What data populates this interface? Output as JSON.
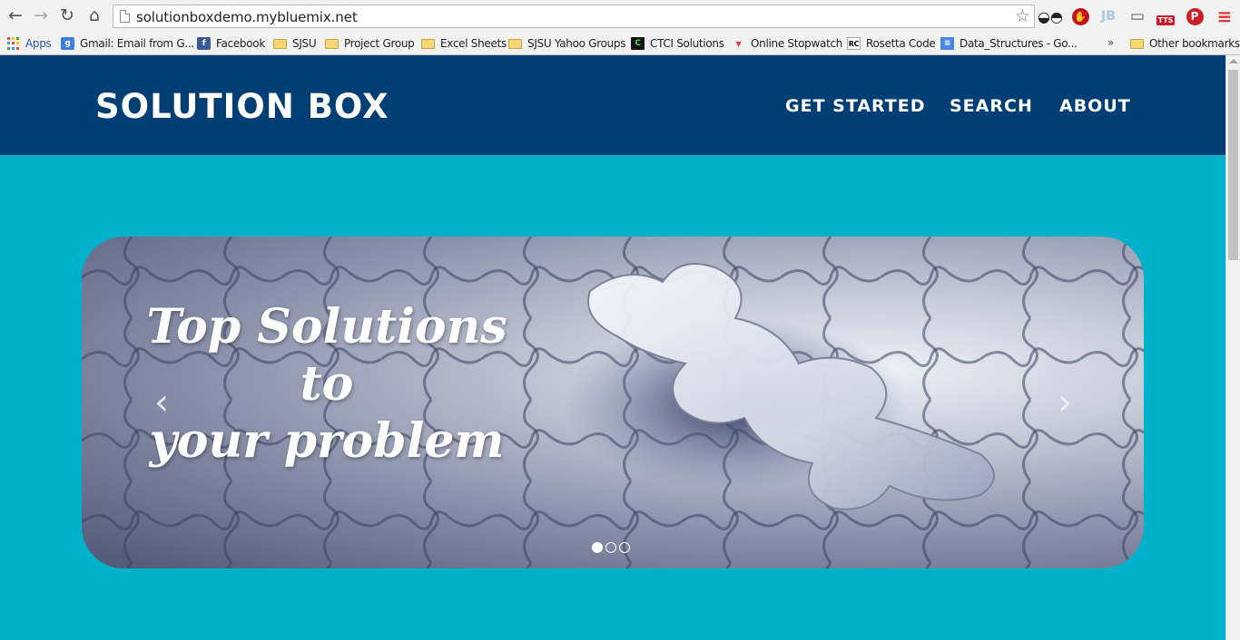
{
  "browser": {
    "url": "solutionboxdemo.mybluemix.net",
    "icons": {
      "back": "back-arrow-icon",
      "forward": "forward-arrow-icon",
      "reload": "reload-icon",
      "home": "home-icon",
      "star": "bookmark-star-icon"
    },
    "extensions": {
      "jb": "JB",
      "tts": "TTS"
    },
    "bookmarks": [
      {
        "label": "Apps",
        "icon": "apps-grid-icon"
      },
      {
        "label": "Gmail: Email from G...",
        "icon": "google-icon"
      },
      {
        "label": "Facebook",
        "icon": "facebook-icon"
      },
      {
        "label": "SJSU",
        "icon": "folder-icon"
      },
      {
        "label": "Project Group",
        "icon": "folder-icon"
      },
      {
        "label": "Excel Sheets",
        "icon": "folder-icon"
      },
      {
        "label": "SJSU Yahoo Groups",
        "icon": "folder-icon"
      },
      {
        "label": "CTCI Solutions",
        "icon": "ctci-icon"
      },
      {
        "label": "Online Stopwatch",
        "icon": "stopwatch-icon"
      },
      {
        "label": "Rosetta Code",
        "icon": "rosetta-icon"
      },
      {
        "label": "Data_Structures - Go...",
        "icon": "docs-icon"
      }
    ],
    "bookmarks_overflow": "»",
    "other_bookmarks": "Other bookmarks"
  },
  "site": {
    "brand": "SOLUTION BOX",
    "nav": [
      "GET STARTED",
      "SEARCH",
      "ABOUT"
    ]
  },
  "carousel": {
    "caption_lines": [
      "Top Solutions",
      "to",
      "your problem"
    ],
    "prev": "‹",
    "next": "›",
    "slide_count": 3,
    "active_index": 0,
    "colors": {
      "background": "#00b1cb",
      "header": "#003e73"
    }
  }
}
